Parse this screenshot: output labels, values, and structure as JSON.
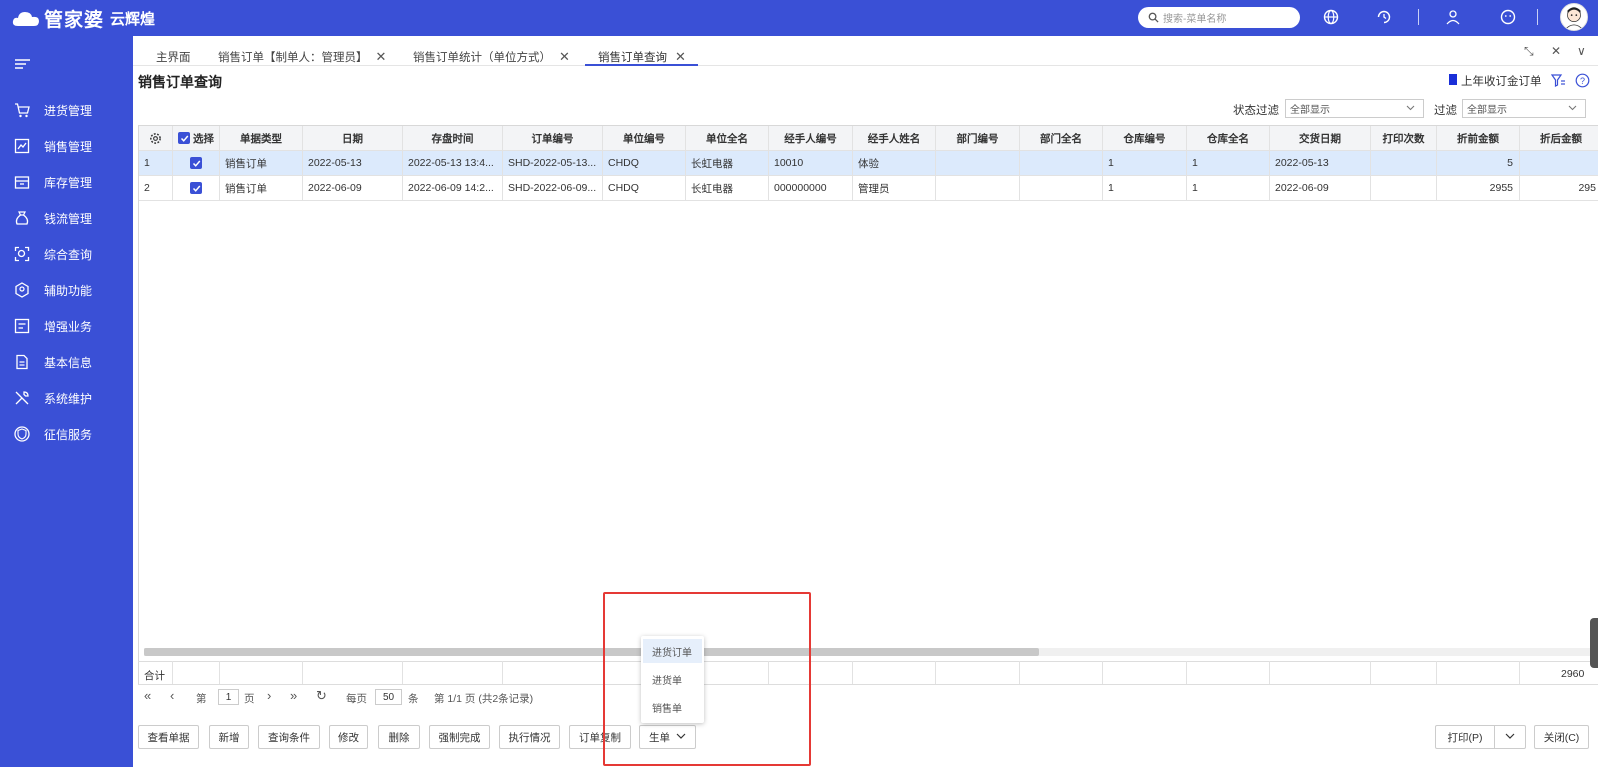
{
  "app": {
    "logo_main": "管家婆",
    "logo_sub": "云辉煌"
  },
  "search": {
    "placeholder": "搜索-菜单名称"
  },
  "sidebar": {
    "items": [
      {
        "label": "进货管理",
        "icon": "cart-icon"
      },
      {
        "label": "销售管理",
        "icon": "sales-icon"
      },
      {
        "label": "库存管理",
        "icon": "box-icon"
      },
      {
        "label": "钱流管理",
        "icon": "money-bag-icon"
      },
      {
        "label": "综合查询",
        "icon": "query-icon"
      },
      {
        "label": "辅助功能",
        "icon": "hexagon-icon"
      },
      {
        "label": "增强业务",
        "icon": "window-icon"
      },
      {
        "label": "基本信息",
        "icon": "document-icon"
      },
      {
        "label": "系统维护",
        "icon": "tools-icon"
      },
      {
        "label": "征信服务",
        "icon": "credit-icon"
      }
    ]
  },
  "tabs": [
    {
      "label": "主界面",
      "closable": false
    },
    {
      "label": "销售订单【制单人：管理员】",
      "closable": true
    },
    {
      "label": "销售订单统计（单位方式）",
      "closable": true
    },
    {
      "label": "销售订单查询",
      "closable": true,
      "active": true
    }
  ],
  "page": {
    "title": "销售订单查询",
    "legend_label": "上年收订金订单",
    "legend_color": "#1a2fd8",
    "status_filter_label": "状态过滤",
    "status_filter_value": "全部显示",
    "filter_label": "过滤",
    "filter_value": "全部显示"
  },
  "grid": {
    "columns": [
      "",
      "选择",
      "单据类型",
      "日期",
      "存盘时间",
      "订单编号",
      "单位编号",
      "单位全名",
      "经手人编号",
      "经手人姓名",
      "部门编号",
      "部门全名",
      "仓库编号",
      "仓库全名",
      "交货日期",
      "打印次数",
      "折前金额",
      "折后金额"
    ],
    "rows": [
      {
        "no": "1",
        "checked": true,
        "type": "销售订单",
        "date": "2022-05-13",
        "saved": "2022-05-13 13:4...",
        "order_no": "SHD-2022-05-13...",
        "unit_no": "CHDQ",
        "unit_name": "长虹电器",
        "handler_no": "10010",
        "handler_name": "体验",
        "dept_no": "",
        "dept_name": "",
        "wh_no": "1",
        "wh_name": "1",
        "delivery": "2022-05-13",
        "print_count": "",
        "pre_amount": "5",
        "post_amount": ""
      },
      {
        "no": "2",
        "checked": true,
        "type": "销售订单",
        "date": "2022-06-09",
        "saved": "2022-06-09 14:2...",
        "order_no": "SHD-2022-06-09...",
        "unit_no": "CHDQ",
        "unit_name": "长虹电器",
        "handler_no": "000000000",
        "handler_name": "管理员",
        "dept_no": "",
        "dept_name": "",
        "wh_no": "1",
        "wh_name": "1",
        "delivery": "2022-06-09",
        "print_count": "",
        "pre_amount": "2955",
        "post_amount": "295"
      }
    ],
    "total_label": "合计",
    "total_pre": "2960",
    "total_post": "296"
  },
  "pager": {
    "page_prefix": "第",
    "page_value": "1",
    "page_suffix": "页",
    "per_page_label": "每页",
    "per_page_value": "50",
    "per_page_unit": "条",
    "summary": "第 1/1 页 (共2条记录)"
  },
  "buttons": {
    "view": "查看单据",
    "new": "新增",
    "query": "查询条件",
    "edit": "修改",
    "delete": "删除",
    "force_complete": "强制完成",
    "execution": "执行情况",
    "copy": "订单复制",
    "generate": "生单",
    "print": "打印(P)",
    "close": "关闭(C)"
  },
  "popup": {
    "items": [
      "进货订单",
      "进货单",
      "销售单"
    ]
  }
}
